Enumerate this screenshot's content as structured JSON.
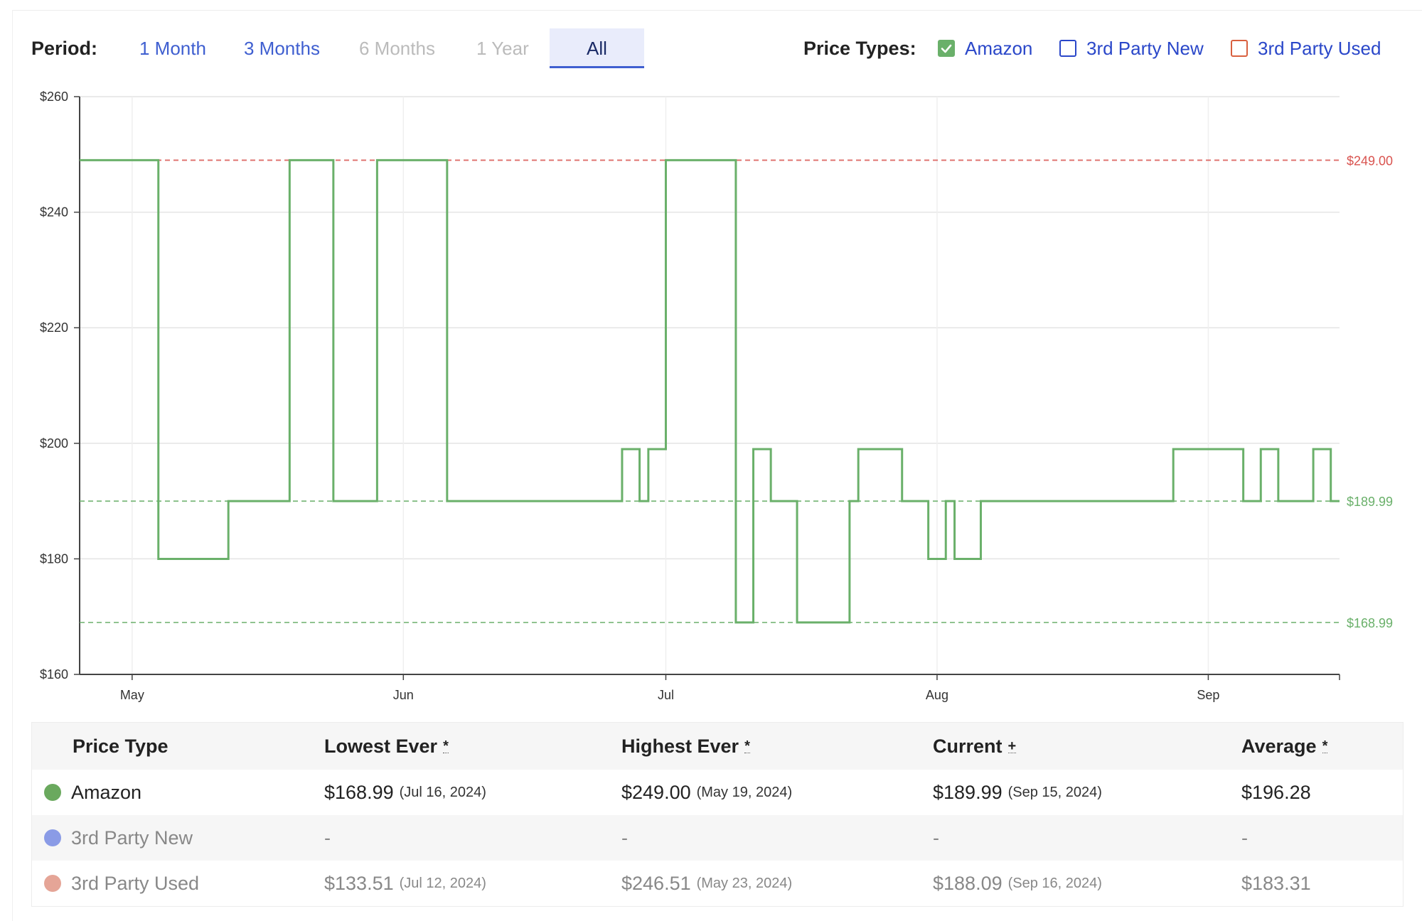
{
  "controls": {
    "period_label": "Period:",
    "periods": [
      {
        "label": "1 Month",
        "state": "enabled"
      },
      {
        "label": "3 Months",
        "state": "enabled"
      },
      {
        "label": "6 Months",
        "state": "disabled"
      },
      {
        "label": "1 Year",
        "state": "disabled"
      },
      {
        "label": "All",
        "state": "active"
      }
    ],
    "price_types_label": "Price Types:",
    "price_types": [
      {
        "label": "Amazon",
        "checked": true,
        "color": "#6ab06a"
      },
      {
        "label": "3rd Party New",
        "checked": false,
        "color": "#2a47c9"
      },
      {
        "label": "3rd Party Used",
        "checked": false,
        "color": "#d9603f"
      }
    ]
  },
  "chart_data": {
    "type": "line",
    "series": [
      {
        "name": "Amazon",
        "color": "#6ab06a",
        "step": true,
        "x": [
          "2024-04-25",
          "2024-05-04",
          "2024-05-12",
          "2024-05-19",
          "2024-05-24",
          "2024-05-29",
          "2024-06-06",
          "2024-06-26",
          "2024-06-28",
          "2024-06-29",
          "2024-07-01",
          "2024-07-09",
          "2024-07-11",
          "2024-07-13",
          "2024-07-16",
          "2024-07-22",
          "2024-07-23",
          "2024-07-28",
          "2024-07-31",
          "2024-08-02",
          "2024-08-03",
          "2024-08-06",
          "2024-08-28",
          "2024-09-05",
          "2024-09-07",
          "2024-09-09",
          "2024-09-13",
          "2024-09-15"
        ],
        "y": [
          249.0,
          179.99,
          189.99,
          249.0,
          189.99,
          249.0,
          189.99,
          198.99,
          189.99,
          198.99,
          249.0,
          168.99,
          198.99,
          189.99,
          168.99,
          189.99,
          198.99,
          189.99,
          179.99,
          189.99,
          179.99,
          189.99,
          198.99,
          189.99,
          198.99,
          189.99,
          198.99,
          189.99
        ]
      }
    ],
    "reference_lines": [
      {
        "value": 249.0,
        "label": "$249.00",
        "color": "#d9534f"
      },
      {
        "value": 189.99,
        "label": "$189.99",
        "color": "#6ab06a"
      },
      {
        "value": 168.99,
        "label": "$168.99",
        "color": "#6ab06a"
      }
    ],
    "x_range": [
      "2024-04-25",
      "2024-09-16"
    ],
    "x_ticks": [
      {
        "date": "2024-05-01",
        "label": "May"
      },
      {
        "date": "2024-06-01",
        "label": "Jun"
      },
      {
        "date": "2024-07-01",
        "label": "Jul"
      },
      {
        "date": "2024-08-01",
        "label": "Aug"
      },
      {
        "date": "2024-09-01",
        "label": "Sep"
      }
    ],
    "ylim": [
      160,
      260
    ],
    "y_ticks": [
      160,
      180,
      200,
      220,
      240,
      260
    ],
    "y_tick_labels": [
      "$160",
      "$180",
      "$200",
      "$220",
      "$240",
      "$260"
    ],
    "grid": true,
    "xlabel": "",
    "ylabel": ""
  },
  "table": {
    "headers": [
      {
        "label": "Price Type",
        "mark": ""
      },
      {
        "label": "Lowest Ever",
        "mark": "*"
      },
      {
        "label": "Highest Ever",
        "mark": "*"
      },
      {
        "label": "Current",
        "mark": "+"
      },
      {
        "label": "Average",
        "mark": "*"
      }
    ],
    "rows": [
      {
        "name": "Amazon",
        "color": "#6aa95e",
        "muted": false,
        "lowest": "$168.99",
        "lowest_date": "(Jul 16, 2024)",
        "highest": "$249.00",
        "highest_date": "(May 19, 2024)",
        "current": "$189.99",
        "current_date": "(Sep 15, 2024)",
        "average": "$196.28"
      },
      {
        "name": "3rd Party New",
        "color": "#8a9be6",
        "muted": true,
        "lowest": "-",
        "lowest_date": "",
        "highest": "-",
        "highest_date": "",
        "current": "-",
        "current_date": "",
        "average": "-"
      },
      {
        "name": "3rd Party Used",
        "color": "#e5a597",
        "muted": true,
        "lowest": "$133.51",
        "lowest_date": "(Jul 12, 2024)",
        "highest": "$246.51",
        "highest_date": "(May 23, 2024)",
        "current": "$188.09",
        "current_date": "(Sep 16, 2024)",
        "average": "$183.31"
      }
    ]
  }
}
